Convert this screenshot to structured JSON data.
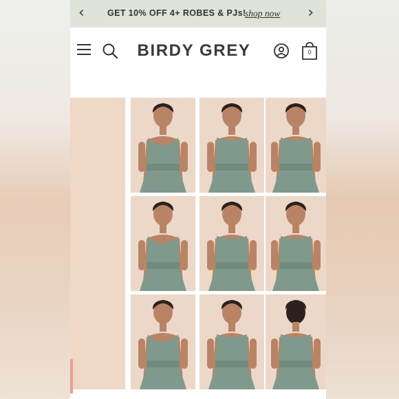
{
  "promo": {
    "text": "GET 10% OFF 4+ ROBES & PJs!",
    "link": "shop now",
    "prev_icon": "chevron-left-icon",
    "next_icon": "chevron-right-icon"
  },
  "header": {
    "logo": "BIRDY GREY",
    "menu_icon": "menu-icon",
    "search_icon": "search-icon",
    "account_icon": "account-icon",
    "bag_icon": "shopping-bag-icon",
    "bag_count": "0"
  },
  "colors": {
    "promo_bg": "#dfe3da",
    "dress": "#7f9a8c",
    "photo_bg": "#ecd8c9",
    "text": "#333333"
  },
  "gallery": {
    "styles": [
      "halter-twist",
      "halter-neck",
      "sweetheart",
      "v-halter",
      "off-shoulder",
      "one-shoulder-drape",
      "flutter-sleeve",
      "strapless-twist",
      "back-cross"
    ]
  }
}
